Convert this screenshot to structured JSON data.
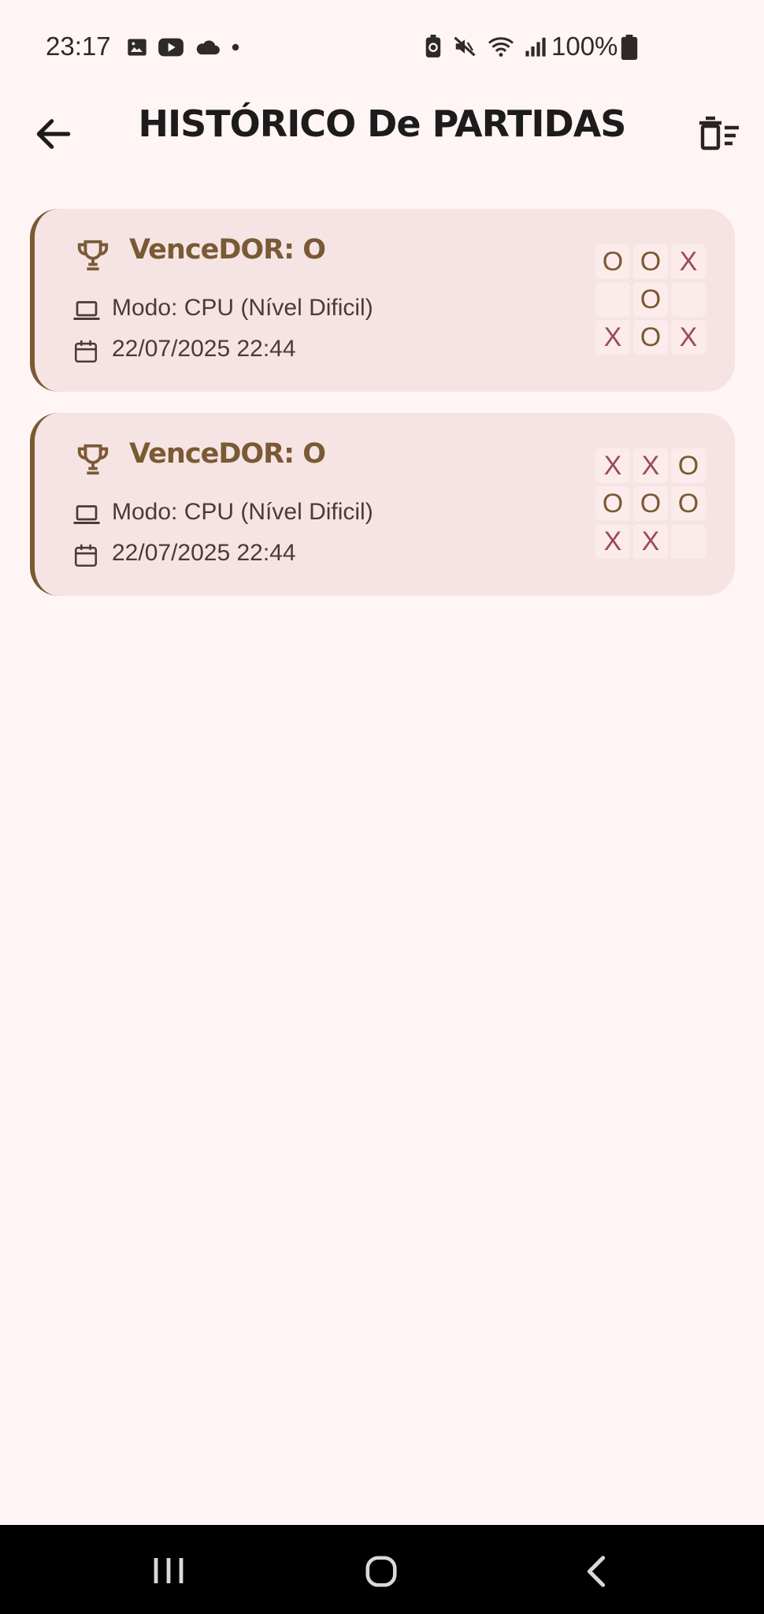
{
  "status_bar": {
    "time": "23:17",
    "battery": "100%",
    "left_icons": [
      "image-icon",
      "youtube-icon",
      "cloud-icon",
      "dot-icon"
    ],
    "right_icons": [
      "battery-saver-icon",
      "mute-icon",
      "wifi-icon",
      "signal-icon",
      "battery-icon"
    ]
  },
  "app_bar": {
    "title": "HISTÓRICO De PARTIDAS",
    "back_icon": "arrow-left-icon",
    "action_icon": "delete-sweep-icon"
  },
  "matches": [
    {
      "winner": "VenceDOR: O",
      "mode": "Modo: CPU (Nível Dificil)",
      "date": "22/07/2025 22:44",
      "board": [
        "O",
        "O",
        "X",
        "",
        "O",
        "",
        "X",
        "O",
        "X"
      ]
    },
    {
      "winner": "VenceDOR: O",
      "mode": "Modo: CPU (Nível Dificil)",
      "date": "22/07/2025 22:44",
      "board": [
        "X",
        "X",
        "O",
        "O",
        "O",
        "O",
        "X",
        "X",
        ""
      ]
    }
  ],
  "colors": {
    "background": "#FFF5F4",
    "card": "#F6E4E5",
    "accent_brown": "#7A5A34",
    "x_color": "#9C4A55"
  },
  "nav_bar": {
    "icons": [
      "recents-icon",
      "home-icon",
      "back-icon"
    ]
  }
}
